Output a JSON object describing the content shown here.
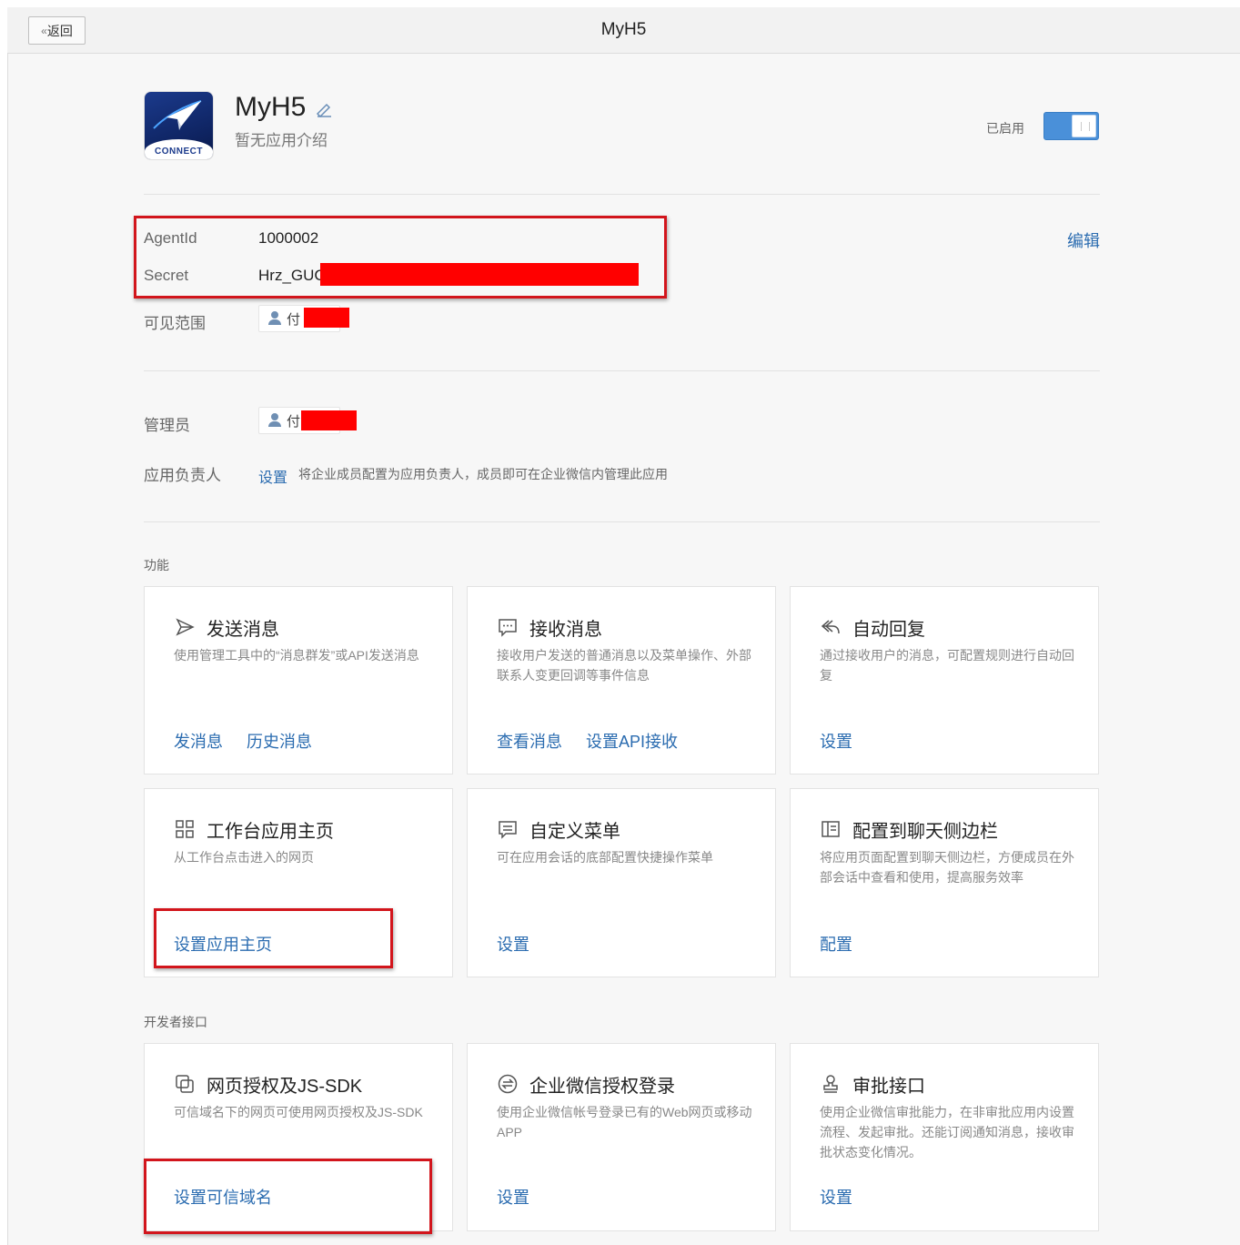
{
  "topbar": {
    "back_label": "返回",
    "title": "MyH5"
  },
  "app": {
    "name": "MyH5",
    "description": "暂无应用介绍",
    "icon_text": "CONNECT",
    "status_label": "已启用",
    "enabled": true
  },
  "details": {
    "edit_label": "编辑",
    "agentid_label": "AgentId",
    "agentid_value": "1000002",
    "secret_label": "Secret",
    "secret_value": "Hrz_GUC",
    "visibility_label": "可见范围",
    "visibility_person": "付",
    "admin_label": "管理员",
    "admin_person": "付",
    "owner_label": "应用负责人",
    "owner_link": "设置",
    "owner_hint": "将企业成员配置为应用负责人，成员即可在企业微信内管理此应用"
  },
  "features": {
    "section_label": "功能",
    "cards": [
      {
        "icon": "send-icon",
        "title": "发送消息",
        "desc": "使用管理工具中的“消息群发”或API发送消息",
        "links": [
          "发消息",
          "历史消息"
        ]
      },
      {
        "icon": "chat-bubble-icon",
        "title": "接收消息",
        "desc": "接收用户发送的普通消息以及菜单操作、外部联系人变更回调等事件信息",
        "links": [
          "查看消息",
          "设置API接收"
        ]
      },
      {
        "icon": "reply-icon",
        "title": "自动回复",
        "desc": "通过接收用户的消息，可配置规则进行自动回复",
        "links": [
          "设置"
        ]
      },
      {
        "icon": "grid-icon",
        "title": "工作台应用主页",
        "desc": "从工作台点击进入的网页",
        "links": [
          "设置应用主页"
        ]
      },
      {
        "icon": "menu-icon",
        "title": "自定义菜单",
        "desc": "可在应用会话的底部配置快捷操作菜单",
        "links": [
          "设置"
        ]
      },
      {
        "icon": "sidebar-icon",
        "title": "配置到聊天侧边栏",
        "desc": "将应用页面配置到聊天侧边栏，方便成员在外部会话中查看和使用，提高服务效率",
        "links": [
          "配置"
        ]
      }
    ]
  },
  "developer": {
    "section_label": "开发者接口",
    "cards": [
      {
        "icon": "webauth-icon",
        "title": "网页授权及JS-SDK",
        "desc": "可信域名下的网页可使用网页授权及JS-SDK",
        "links": [
          "设置可信域名"
        ]
      },
      {
        "icon": "login-icon",
        "title": "企业微信授权登录",
        "desc": "使用企业微信帐号登录已有的Web网页或移动APP",
        "links": [
          "设置"
        ]
      },
      {
        "icon": "stamp-icon",
        "title": "审批接口",
        "desc": "使用企业微信审批能力，在非审批应用内设置流程、发起审批。还能订阅通知消息，接收审批状态变化情况。",
        "links": [
          "设置"
        ]
      }
    ]
  },
  "colors": {
    "link": "#2b6cb0",
    "toggle": "#4a90d9",
    "annotation": "#d2151c",
    "redaction": "#ff0000"
  }
}
